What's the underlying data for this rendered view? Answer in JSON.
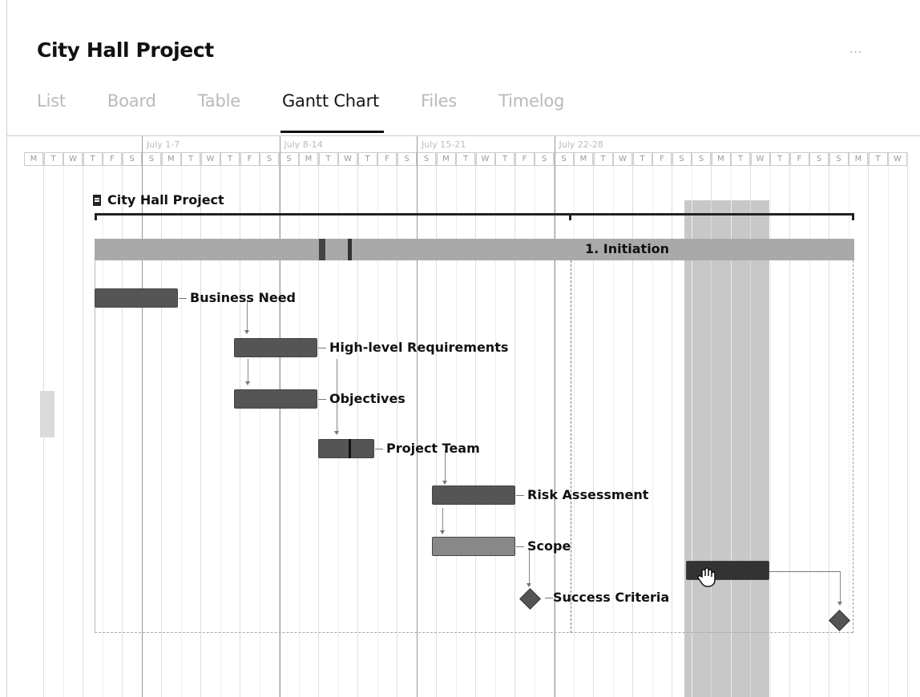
{
  "project": {
    "title": "City Hall Project",
    "more": "..."
  },
  "tabs": [
    "List",
    "Board",
    "Table",
    "Gantt Chart",
    "Files",
    "Timelog"
  ],
  "active_tab": "Gantt Chart",
  "gantt": {
    "weeks": [
      "July 1-7",
      "July 8-14",
      "July 15-21",
      "July 22-28"
    ],
    "days": [
      "M",
      "T",
      "W",
      "T",
      "F",
      "S",
      "S",
      "M",
      "T",
      "W",
      "T",
      "F",
      "S",
      "S",
      "M",
      "T",
      "W",
      "T",
      "F",
      "S",
      "S",
      "M",
      "T",
      "W",
      "T",
      "F",
      "S",
      "S",
      "M",
      "T",
      "W",
      "T",
      "F",
      "S",
      "S",
      "M",
      "T",
      "W",
      "T",
      "F",
      "S",
      "S",
      "M",
      "T",
      "W"
    ],
    "project_label": "City Hall Project",
    "phase_label": "1. Initiation",
    "tasks": [
      {
        "name": "Business Need"
      },
      {
        "name": "High-level Requirements"
      },
      {
        "name": "Objectives"
      },
      {
        "name": "Project Team"
      },
      {
        "name": "Risk Assessment"
      },
      {
        "name": "Scope"
      },
      {
        "name": "Success Criteria"
      }
    ]
  },
  "icons": {
    "project": "clipboard-icon",
    "more": "more-dots-icon",
    "cursor": "hand-cursor-icon"
  },
  "colors": {
    "bar": "#555555",
    "phase": "#a9a9a9",
    "highlight": "#c8c8c8"
  }
}
